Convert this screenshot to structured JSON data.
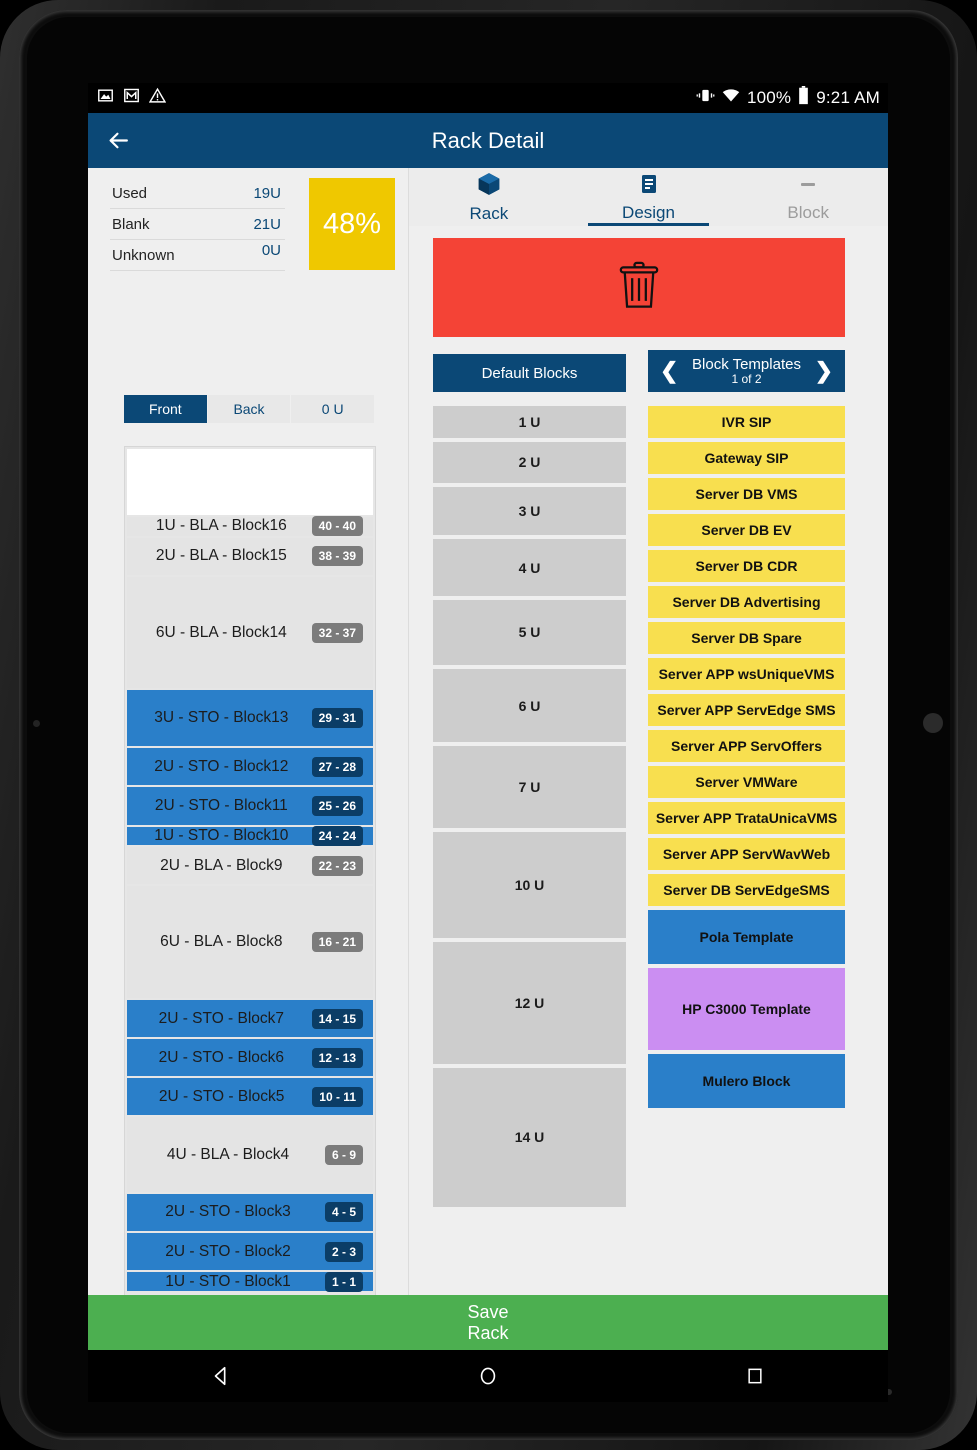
{
  "status_bar": {
    "left_icons": [
      "image-icon",
      "gmail-icon",
      "warning-icon"
    ],
    "right_icons": [
      "vibrate-icon",
      "wifi-icon",
      "battery-icon"
    ],
    "battery_percent": "100%",
    "clock": "9:21 AM"
  },
  "app_bar": {
    "back_icon": "back-arrow-icon",
    "title": "Rack Detail"
  },
  "stats": {
    "rows": [
      {
        "label": "Used",
        "value": "19U"
      },
      {
        "label": "Blank",
        "value": "21U"
      },
      {
        "label": "Unknown",
        "value": "0U"
      }
    ],
    "percent": "48%",
    "percent_color": "#efc800"
  },
  "view_toggle": {
    "segments": [
      {
        "label": "Front",
        "active": true
      },
      {
        "label": "Back",
        "active": false
      },
      {
        "label": "0 U",
        "active": false
      }
    ]
  },
  "rack_list": [
    {
      "name": "1U - BLA - Block16",
      "range": "40 - 40",
      "units": 1,
      "type": "blank"
    },
    {
      "name": "2U - BLA - Block15",
      "range": "38 - 39",
      "units": 2,
      "type": "blank"
    },
    {
      "name": "6U - BLA - Block14",
      "range": "32 - 37",
      "units": 6,
      "type": "blank"
    },
    {
      "name": "3U - STO - Block13",
      "range": "29 - 31",
      "units": 3,
      "type": "used"
    },
    {
      "name": "2U - STO - Block12",
      "range": "27 - 28",
      "units": 2,
      "type": "used"
    },
    {
      "name": "2U - STO - Block11",
      "range": "25 - 26",
      "units": 2,
      "type": "used"
    },
    {
      "name": "1U - STO - Block10",
      "range": "24 - 24",
      "units": 1,
      "type": "used"
    },
    {
      "name": "2U - BLA - Block9",
      "range": "22 - 23",
      "units": 2,
      "type": "blank"
    },
    {
      "name": "6U - BLA - Block8",
      "range": "16 - 21",
      "units": 6,
      "type": "blank"
    },
    {
      "name": "2U - STO - Block7",
      "range": "14 - 15",
      "units": 2,
      "type": "used"
    },
    {
      "name": "2U - STO - Block6",
      "range": "12 - 13",
      "units": 2,
      "type": "used"
    },
    {
      "name": "2U - STO - Block5",
      "range": "10 - 11",
      "units": 2,
      "type": "used"
    },
    {
      "name": "4U - BLA - Block4",
      "range": "6 - 9",
      "units": 4,
      "type": "blank"
    },
    {
      "name": "2U - STO - Block3",
      "range": "4 - 5",
      "units": 2,
      "type": "used"
    },
    {
      "name": "2U - STO - Block2",
      "range": "2 - 3",
      "units": 2,
      "type": "used"
    },
    {
      "name": "1U - STO - Block1",
      "range": "1 - 1",
      "units": 1,
      "type": "used"
    }
  ],
  "tabs": [
    {
      "label": "Rack",
      "icon": "cube-icon",
      "active": false,
      "disabled": false
    },
    {
      "label": "Design",
      "icon": "list-icon",
      "active": true,
      "disabled": false
    },
    {
      "label": "Block",
      "icon": "dash-icon",
      "active": false,
      "disabled": true
    }
  ],
  "trash_zone": {
    "icon": "trash-icon",
    "color": "#f44336"
  },
  "actions": {
    "default_blocks_label": "Default Blocks",
    "templates_title": "Block Templates",
    "templates_page": "1 of 2",
    "prev_icon": "chevron-left-icon",
    "next_icon": "chevron-right-icon"
  },
  "default_blocks": [
    {
      "label": "1 U",
      "units": 1
    },
    {
      "label": "2 U",
      "units": 2
    },
    {
      "label": "3 U",
      "units": 3
    },
    {
      "label": "4 U",
      "units": 4
    },
    {
      "label": "5 U",
      "units": 5
    },
    {
      "label": "6 U",
      "units": 6
    },
    {
      "label": "7 U",
      "units": 7
    },
    {
      "label": "10 U",
      "units": 10
    },
    {
      "label": "12 U",
      "units": 12
    },
    {
      "label": "14 U",
      "units": 14
    }
  ],
  "block_templates": [
    {
      "label": "IVR SIP",
      "units": 1,
      "color": "#f8df4f"
    },
    {
      "label": "Gateway SIP",
      "units": 1,
      "color": "#f8df4f"
    },
    {
      "label": "Server DB VMS",
      "units": 1,
      "color": "#f8df4f"
    },
    {
      "label": "Server DB EV",
      "units": 1,
      "color": "#f8df4f"
    },
    {
      "label": "Server DB CDR",
      "units": 1,
      "color": "#f8df4f"
    },
    {
      "label": "Server DB Advertising",
      "units": 1,
      "color": "#f8df4f"
    },
    {
      "label": "Server DB Spare",
      "units": 1,
      "color": "#f8df4f"
    },
    {
      "label": "Server APP wsUniqueVMS",
      "units": 1,
      "color": "#f8df4f"
    },
    {
      "label": "Server APP ServEdge SMS",
      "units": 1,
      "color": "#f8df4f"
    },
    {
      "label": "Server APP ServOffers",
      "units": 1,
      "color": "#f8df4f"
    },
    {
      "label": "Server VMWare",
      "units": 1,
      "color": "#f8df4f"
    },
    {
      "label": "Server APP TrataUnicaVMS",
      "units": 1,
      "color": "#f8df4f"
    },
    {
      "label": "Server APP ServWavWeb",
      "units": 1,
      "color": "#f8df4f"
    },
    {
      "label": "Server DB ServEdgeSMS",
      "units": 1,
      "color": "#f8df4f"
    },
    {
      "label": "Pola Template",
      "units": 2,
      "color": "#2a7fc9"
    },
    {
      "label": "HP C3000 Template",
      "units": 4,
      "color": "#cb8ef2"
    },
    {
      "label": "Mulero Block",
      "units": 2,
      "color": "#2a7fc9"
    }
  ],
  "save_bar": {
    "line1": "Save",
    "line2": "Rack",
    "color": "#4caf50"
  },
  "nav_bar": {
    "icons": [
      "back-triangle-icon",
      "home-circle-icon",
      "recents-square-icon"
    ]
  }
}
